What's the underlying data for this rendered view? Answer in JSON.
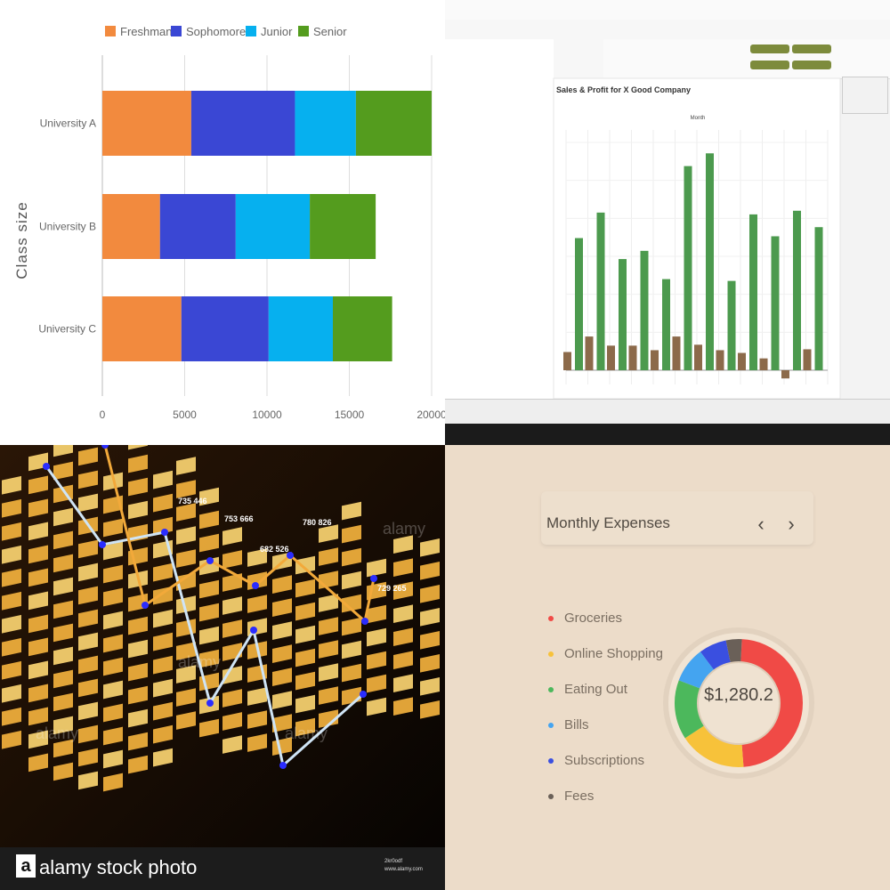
{
  "panels": {
    "top_left": {
      "legend": [
        "Freshman",
        "Sophomore",
        "Junior",
        "Senior"
      ],
      "ylabel": "Class size"
    },
    "top_right": {
      "chart_title": "Sales & Profit for X Good Company",
      "subheader": "Month"
    },
    "bottom_right": {
      "title": "Monthly Expenses",
      "center_value": "$1,280.2",
      "prev_icon": "chevron-left-icon",
      "next_icon": "chevron-right-icon"
    },
    "bottom_left": {
      "watermark": "alamy stock photo",
      "watermark_logo": "a",
      "image_id": "2kr0odf",
      "site": "www.alamy.com",
      "labels": [
        "753 666",
        "682 526",
        "780 826",
        "729 265",
        "735 446"
      ]
    }
  },
  "chart_data": [
    {
      "type": "bar",
      "orientation": "horizontal",
      "stacked": true,
      "categories": [
        "University A",
        "University B",
        "University C"
      ],
      "series": [
        {
          "name": "Freshman",
          "values": [
            5400,
            3500,
            4800
          ]
        },
        {
          "name": "Sophomore",
          "values": [
            6300,
            4600,
            5300
          ]
        },
        {
          "name": "Junior",
          "values": [
            3700,
            4500,
            3900
          ]
        },
        {
          "name": "Senior",
          "values": [
            4600,
            4000,
            3600
          ]
        }
      ],
      "colors": [
        "#f28a3e",
        "#3a47d4",
        "#06b0ef",
        "#549c1e"
      ],
      "ylabel": "Class size",
      "xlim": [
        0,
        20000
      ],
      "xticks": [
        0,
        5000,
        10000,
        15000,
        20000
      ],
      "legend": "top",
      "grid": true
    },
    {
      "type": "bar",
      "title": "Sales & Profit for X Good Company",
      "series": [
        {
          "values": [
            145,
            173,
            122,
            131,
            100,
            224,
            238,
            98,
            171,
            147,
            175,
            157
          ]
        },
        {
          "values": [
            20,
            37,
            27,
            27,
            22,
            37,
            28,
            22,
            19,
            13,
            -9,
            23
          ]
        }
      ],
      "colors": [
        "#4c9a4e",
        "#8c6a4a"
      ],
      "legend": "right",
      "grid": true
    },
    {
      "type": "pie",
      "donut": true,
      "title": "Monthly Expenses",
      "labels": [
        "Groceries",
        "Online Shopping",
        "Eating Out",
        "Bills",
        "Subscriptions",
        "Fees"
      ],
      "values": [
        48,
        17,
        15,
        9,
        7,
        4
      ],
      "colors": [
        "#f04a46",
        "#f7c23a",
        "#4cb85c",
        "#44a4f0",
        "#3a4fe0",
        "#6a6058"
      ],
      "center_label": "$1,280.2",
      "legend": "left"
    },
    {
      "type": "line",
      "series": [
        {
          "values": [
            6,
            4,
            4,
            2,
            1,
            0,
            3,
            1,
            2
          ]
        },
        {
          "values": [
            8,
            3,
            5,
            3,
            5,
            4,
            2,
            5,
            1
          ]
        }
      ],
      "colors": [
        "#cfe4f5",
        "#f2a93a"
      ]
    }
  ]
}
